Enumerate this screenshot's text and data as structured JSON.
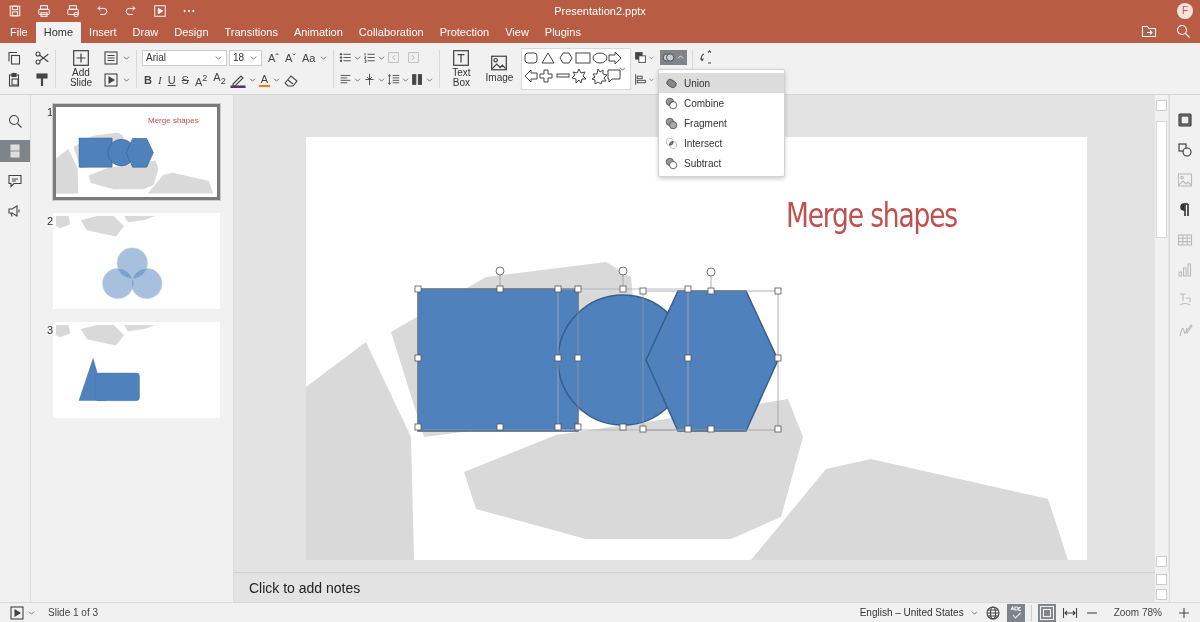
{
  "title_bar": {
    "title": "Presentation2.pptx",
    "avatar": "F"
  },
  "menu_tabs": [
    {
      "label": "File",
      "selected": false
    },
    {
      "label": "Home",
      "selected": true
    },
    {
      "label": "Insert",
      "selected": false
    },
    {
      "label": "Draw",
      "selected": false
    },
    {
      "label": "Design",
      "selected": false
    },
    {
      "label": "Transitions",
      "selected": false
    },
    {
      "label": "Animation",
      "selected": false
    },
    {
      "label": "Collaboration",
      "selected": false
    },
    {
      "label": "Protection",
      "selected": false
    },
    {
      "label": "View",
      "selected": false
    },
    {
      "label": "Plugins",
      "selected": false
    }
  ],
  "toolbar": {
    "add_slide": "Add Slide",
    "font_name": "Arial",
    "font_size": "18",
    "case_buttons": [
      "Aˆ",
      "Aˇ",
      "Aa"
    ],
    "style_buttons": [
      {
        "label": "B",
        "kind": "bold"
      },
      {
        "label": "I",
        "kind": "italic"
      },
      {
        "label": "U",
        "kind": "underline"
      },
      {
        "label": "S",
        "kind": "strike"
      },
      {
        "label": "A$^{2}$",
        "kind": "plain"
      },
      {
        "label": "A$_{2}$",
        "kind": "plain"
      }
    ],
    "font_color": {
      "label": "A"
    },
    "text_box": "Text Box",
    "image": "Image",
    "merge_open": true
  },
  "merge_menu": [
    {
      "label": "Union",
      "selected": true
    },
    {
      "label": "Combine",
      "selected": false
    },
    {
      "label": "Fragment",
      "selected": false
    },
    {
      "label": "Intersect",
      "selected": false
    },
    {
      "label": "Subtract",
      "selected": false
    }
  ],
  "side_tools": [
    {
      "kind": "search",
      "selected": false
    },
    {
      "kind": "slides",
      "selected": true
    },
    {
      "kind": "comments",
      "selected": false
    },
    {
      "kind": "feedback",
      "selected": false
    }
  ],
  "slides": [
    {
      "number": "1",
      "selected": true,
      "kind": "merge",
      "title": "Merge shapes"
    },
    {
      "number": "2",
      "selected": false,
      "kind": "circles"
    },
    {
      "number": "3",
      "selected": false,
      "kind": "callout"
    }
  ],
  "slide": {
    "title": "Merge shapes"
  },
  "notes": {
    "placeholder": "Click to add notes"
  },
  "right_tools": [
    {
      "kind": "slide",
      "disabled": false
    },
    {
      "kind": "shape",
      "disabled": false
    },
    {
      "kind": "image",
      "disabled": true
    },
    {
      "kind": "paragraph",
      "disabled": false
    },
    {
      "kind": "table",
      "disabled": true
    },
    {
      "kind": "chart",
      "disabled": true
    },
    {
      "kind": "textart",
      "disabled": true
    },
    {
      "kind": "signature",
      "disabled": true
    }
  ],
  "status_bar": {
    "slide_info": "Slide 1 of 3",
    "language": "English – United States",
    "spellcheck_on": true,
    "fit_slide_on": true,
    "zoom": "Zoom 78%"
  }
}
